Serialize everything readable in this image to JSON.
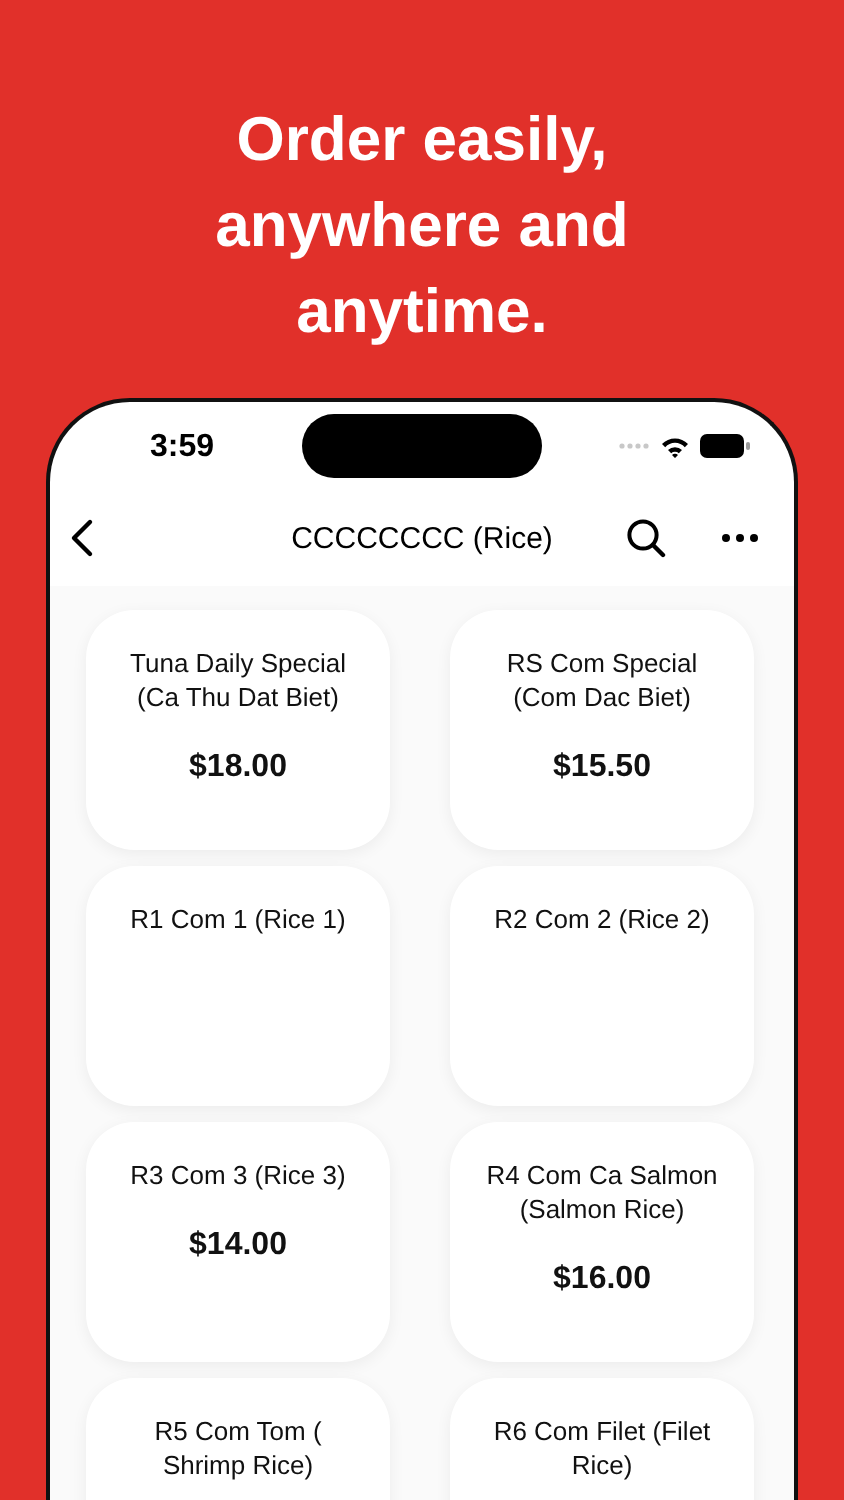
{
  "headline": "Order easily, anywhere and anytime.",
  "status_bar": {
    "time": "3:59"
  },
  "nav": {
    "title": "CCCCCCCC (Rice)"
  },
  "items": [
    {
      "name": "Tuna Daily Special (Ca Thu Dat Biet)",
      "price": "$18.00"
    },
    {
      "name": "RS Com Special (Com Dac Biet)",
      "price": "$15.50"
    },
    {
      "name": "R1 Com 1 (Rice 1)"
    },
    {
      "name": "R2 Com 2 (Rice 2)"
    },
    {
      "name": "R3 Com 3 (Rice 3)",
      "price": "$14.00"
    },
    {
      "name": "R4 Com Ca Salmon (Salmon Rice)",
      "price": "$16.00"
    },
    {
      "name": "R5 Com Tom ( Shrimp Rice)"
    },
    {
      "name": "R6 Com Filet (Filet Rice)"
    }
  ]
}
